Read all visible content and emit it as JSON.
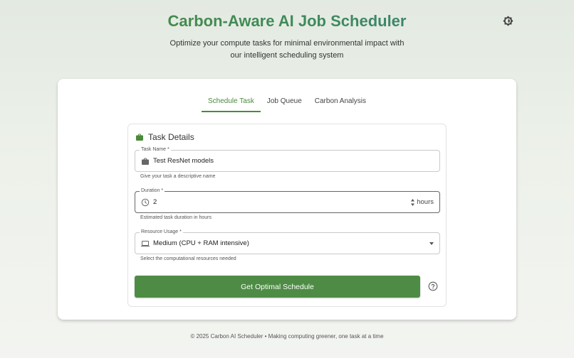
{
  "header": {
    "title": "Carbon-Aware AI Job Scheduler",
    "subtitle": "Optimize your compute tasks for minimal environmental impact with our intelligent scheduling system"
  },
  "theme_toggle": {
    "icon": "brightness-icon"
  },
  "tabs": [
    {
      "label": "Schedule Task",
      "active": true
    },
    {
      "label": "Job Queue",
      "active": false
    },
    {
      "label": "Carbon Analysis",
      "active": false
    }
  ],
  "form": {
    "title": "Task Details",
    "task_name": {
      "label": "Task Name *",
      "value": "Test ResNet models",
      "helper": "Give your task a descriptive name",
      "icon": "briefcase-icon"
    },
    "duration": {
      "label": "Duration *",
      "value": "2",
      "unit": "hours",
      "helper": "Estimated task duration in hours",
      "icon": "clock-icon"
    },
    "resource_usage": {
      "label": "Resource Usage *",
      "value": "Medium (CPU + RAM intensive)",
      "helper": "Select the computational resources needed",
      "icon": "laptop-icon"
    },
    "submit_label": "Get Optimal Schedule"
  },
  "footer": {
    "text": "© 2025 Carbon AI Scheduler • Making computing greener, one task at a time"
  },
  "colors": {
    "accent": "#4a8a3a",
    "button": "#4e8c45"
  }
}
